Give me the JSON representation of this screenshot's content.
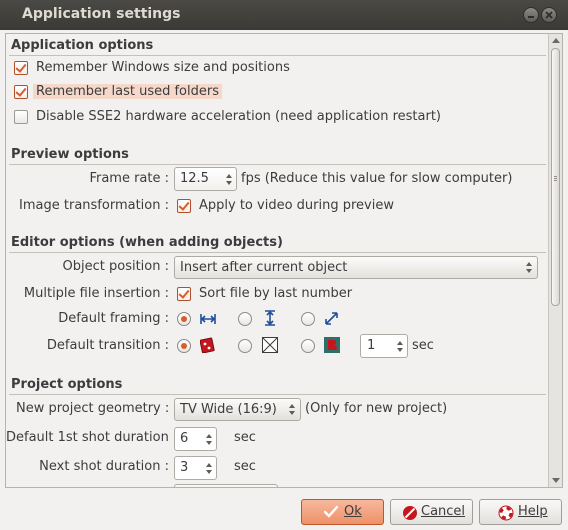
{
  "window": {
    "title": "Application settings"
  },
  "sections": {
    "application": {
      "title": "Application options",
      "remember_window": {
        "label": "Remember Windows size and positions",
        "checked": true
      },
      "remember_folders": {
        "label": "Remember last used folders",
        "checked": true
      },
      "disable_sse2": {
        "label": "Disable SSE2 hardware acceleration (need application restart)",
        "checked": false
      }
    },
    "preview": {
      "title": "Preview options",
      "frame_rate_label": "Frame rate :",
      "frame_rate_value": "12.5",
      "frame_rate_hint": "fps (Reduce this value for slow computer)",
      "image_transformation_label": "Image transformation :",
      "apply_video_label": "Apply to video during preview"
    },
    "editor": {
      "title": "Editor options (when adding objects)",
      "object_position_label": "Object position :",
      "object_position_value": "Insert after current object",
      "multiple_insertion_label": "Multiple file insertion :",
      "sort_file_label": "Sort file by last number",
      "default_framing_label": "Default framing :",
      "default_transition_label": "Default transition :",
      "transition_duration_value": "1",
      "transition_unit": "sec"
    },
    "project": {
      "title": "Project options",
      "geometry_label": "New project geometry :",
      "geometry_value": "TV Wide (16:9)",
      "geometry_hint": "(Only for new project)",
      "first_shot_label": "Default 1st shot duration :",
      "first_shot_value": "6",
      "first_shot_unit": "sec",
      "next_shot_label": "Next shot duration :",
      "next_shot_value": "3",
      "next_shot_unit": "sec"
    }
  },
  "buttons": {
    "ok": "Ok",
    "cancel": "Cancel",
    "help": "Help"
  },
  "colors": {
    "accent": "#d85d2a",
    "titlebar": "#3c3b37",
    "background": "#f2f1f0"
  }
}
